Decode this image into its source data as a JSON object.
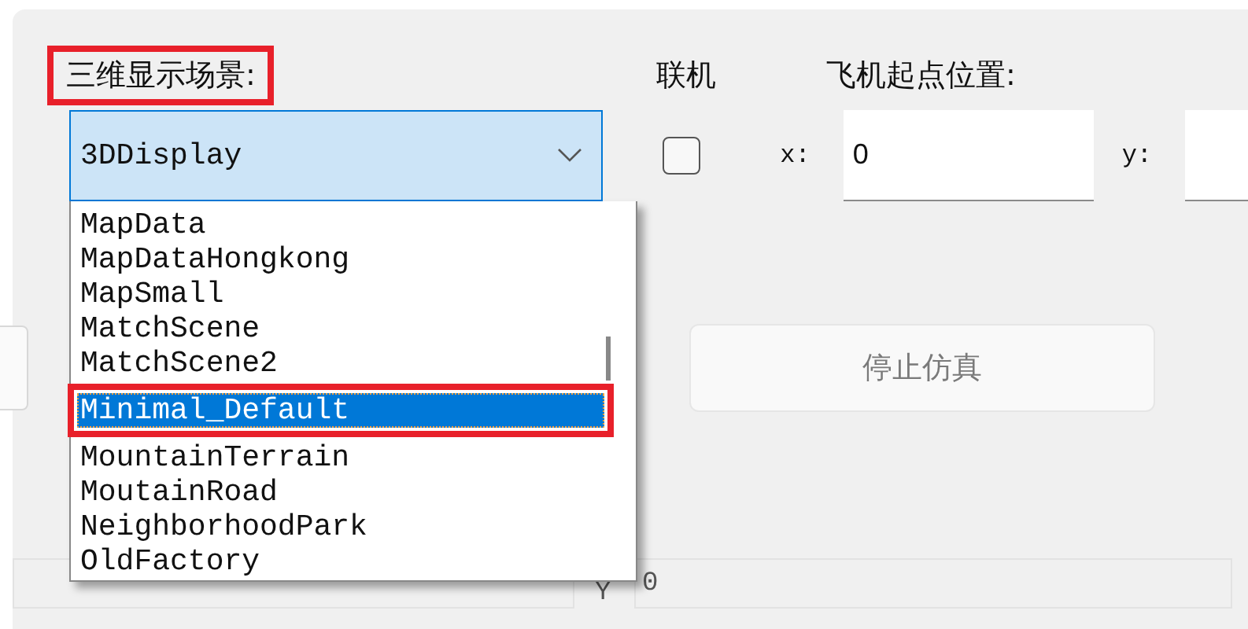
{
  "scene": {
    "label": "三维显示场景:",
    "highlighted": true,
    "value": "3DDisplay",
    "open": true,
    "items": [
      {
        "label": "MapData",
        "selected": false,
        "highlighted": false
      },
      {
        "label": "MapDataHongkong",
        "selected": false,
        "highlighted": false
      },
      {
        "label": "MapSmall",
        "selected": false,
        "highlighted": false
      },
      {
        "label": "MatchScene",
        "selected": false,
        "highlighted": false
      },
      {
        "label": "MatchScene2",
        "selected": false,
        "highlighted": false
      },
      {
        "label": "Minimal_Default",
        "selected": true,
        "highlighted": true
      },
      {
        "label": "MountainTerrain",
        "selected": false,
        "highlighted": false
      },
      {
        "label": "MoutainRoad",
        "selected": false,
        "highlighted": false
      },
      {
        "label": "NeighborhoodPark",
        "selected": false,
        "highlighted": false
      },
      {
        "label": "OldFactory",
        "selected": false,
        "highlighted": false
      }
    ]
  },
  "online": {
    "label": "联机",
    "checked": false
  },
  "start_position": {
    "label": "飞机起点位置:",
    "x_label": "x:",
    "x_value": "0",
    "y_label": "y:"
  },
  "stop_button": {
    "label": "停止仿真",
    "disabled": true
  },
  "status_bar": {
    "y_label": "Y",
    "y_value": "0"
  }
}
